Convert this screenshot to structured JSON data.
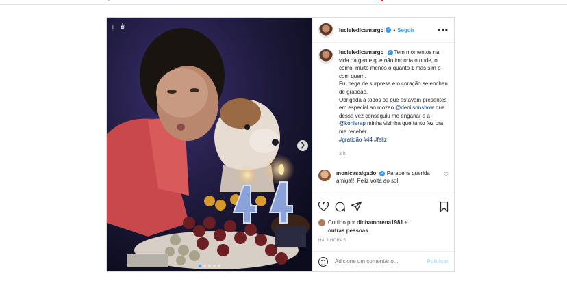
{
  "header": {
    "username": "lucieledicamargo",
    "separator": "•",
    "follow_label": "Seguir",
    "more_label": "•••"
  },
  "caption": {
    "username": "lucieledicamargo",
    "text1": "Tem momentos na vida da gente que não importa o onde, o como, muito menos o quanto $ mas sim o com quem.",
    "text2": "Fui pega de surpresa e o coração se encheu de gratidão.",
    "text3a": "Obrigada a todos os que estavam presentes em especial ao mozao",
    "mention1": "@denilsonshow",
    "text3b": "que dessa vez conseguiu me enganar e a",
    "mention2": "@kohlerap",
    "text3c": "minha vizinha que tanto fez pra me receber.",
    "hashtags": "#gratidão #44 #feliz",
    "time": "3 h"
  },
  "comment": {
    "username": "monicasalgado",
    "text": "Parabens querida amiga!!! Feliz volta ao sol!"
  },
  "likes": {
    "prefix": "Curtido por",
    "user": "dinhamorena1981",
    "connector": "e",
    "others": "outras pessoas"
  },
  "post_time": "HÁ 3 HORAS",
  "add_comment": {
    "placeholder": "Adicione um comentário...",
    "publish_label": "Publicar"
  },
  "icons": {
    "like": "heart-icon",
    "comment": "comment-icon",
    "share": "share-icon",
    "save": "bookmark-icon",
    "emoji": "emoji-icon",
    "next": "chevron-right-icon"
  },
  "carousel": {
    "total_slides": 5,
    "active_slide": 1
  },
  "colors": {
    "accent": "#3897f0",
    "link": "#00376b",
    "muted": "#8e8e8e",
    "publish_disabled": "#b2dffc"
  }
}
